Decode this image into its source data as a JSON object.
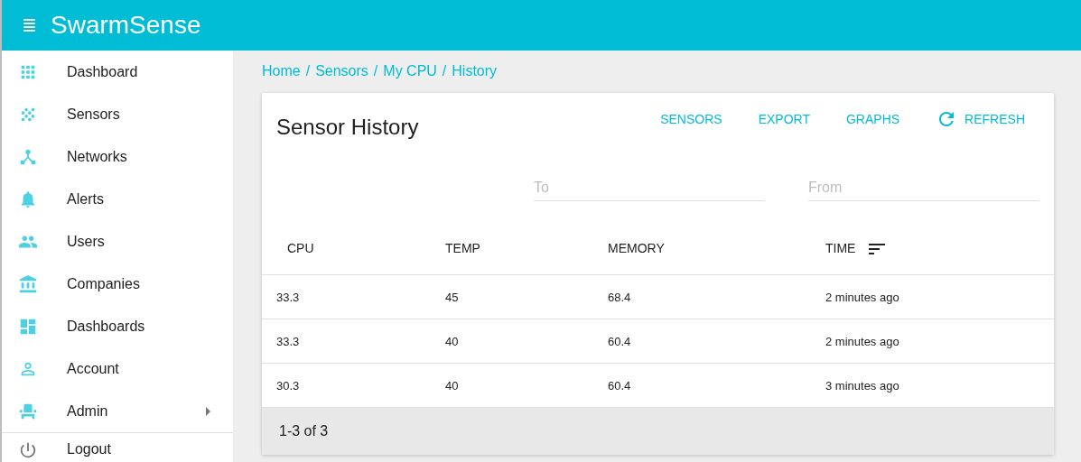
{
  "app_bar": {
    "menu_icon": "≣",
    "title": "SwarmSense"
  },
  "sidebar": {
    "items": [
      {
        "label": "Dashboard",
        "has_submenu": false
      },
      {
        "label": "Sensors",
        "has_submenu": false
      },
      {
        "label": "Networks",
        "has_submenu": false
      },
      {
        "label": "Alerts",
        "has_submenu": false
      },
      {
        "label": "Users",
        "has_submenu": false
      },
      {
        "label": "Companies",
        "has_submenu": false
      },
      {
        "label": "Dashboards",
        "has_submenu": false
      },
      {
        "label": "Account",
        "has_submenu": false
      },
      {
        "label": "Admin",
        "has_submenu": true
      }
    ],
    "footer_items": [
      {
        "label": "Logout"
      }
    ]
  },
  "breadcrumb": {
    "separator": "/",
    "items": [
      "Home",
      "Sensors",
      "My CPU",
      "History"
    ]
  },
  "card": {
    "title": "Sensor History",
    "actions": [
      {
        "label": "SENSORS",
        "kind": "text"
      },
      {
        "label": "EXPORT",
        "kind": "text"
      },
      {
        "label": "GRAPHS",
        "kind": "text"
      },
      {
        "label": "REFRESH",
        "kind": "refresh"
      }
    ],
    "filters": [
      {
        "placeholder": "To"
      },
      {
        "placeholder": "From"
      }
    ],
    "table": {
      "columns": [
        {
          "label": "CPU",
          "sorted": false
        },
        {
          "label": "TEMP",
          "sorted": false
        },
        {
          "label": "MEMORY",
          "sorted": false
        },
        {
          "label": "TIME",
          "sorted": true
        }
      ],
      "rows": [
        [
          "33.3",
          "45",
          "68.4",
          "2 minutes ago"
        ],
        [
          "33.3",
          "40",
          "60.4",
          "2 minutes ago"
        ],
        [
          "30.3",
          "40",
          "60.4",
          "3 minutes ago"
        ]
      ]
    },
    "pagination": "1-3 of 3"
  }
}
